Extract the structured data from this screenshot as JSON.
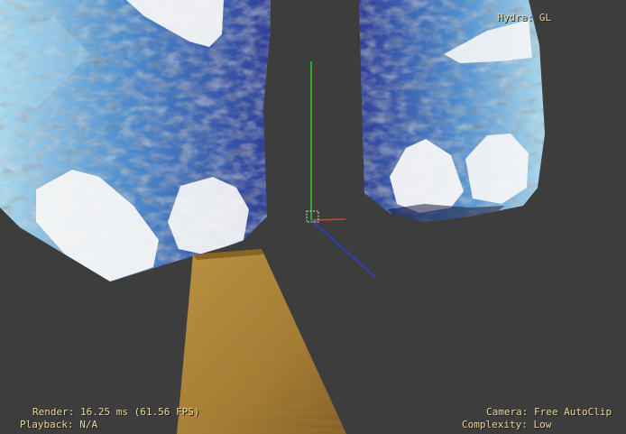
{
  "viewport": {
    "background_color": "#3d3d3d",
    "hud_text_color": "#e8d694",
    "renderer": "Hydra: GL",
    "render_time": "Render: 16.25 ms (61.56 FPS)",
    "playback": "Playback: N/A",
    "camera": "Camera: Free AutoClip",
    "complexity": "Complexity: Low"
  },
  "scene": {
    "left_object": {
      "color_dark": "#2e3f98",
      "color_mid": "#4f8fd0",
      "color_light": "#a9dbf0",
      "color_white": "#f6f6f6"
    },
    "right_object": {
      "color_dark": "#2e3f98",
      "color_mid": "#4f8fd0",
      "color_light": "#a9dbf0",
      "color_white": "#f6f6f6"
    },
    "plank": {
      "color_base": "#a67a2d",
      "color_dark": "#7f5a1e",
      "color_light": "#c1953e"
    },
    "axes": {
      "x_color": "#e03a3a",
      "y_color": "#2ad02a",
      "z_color": "#2a3fe0"
    }
  }
}
